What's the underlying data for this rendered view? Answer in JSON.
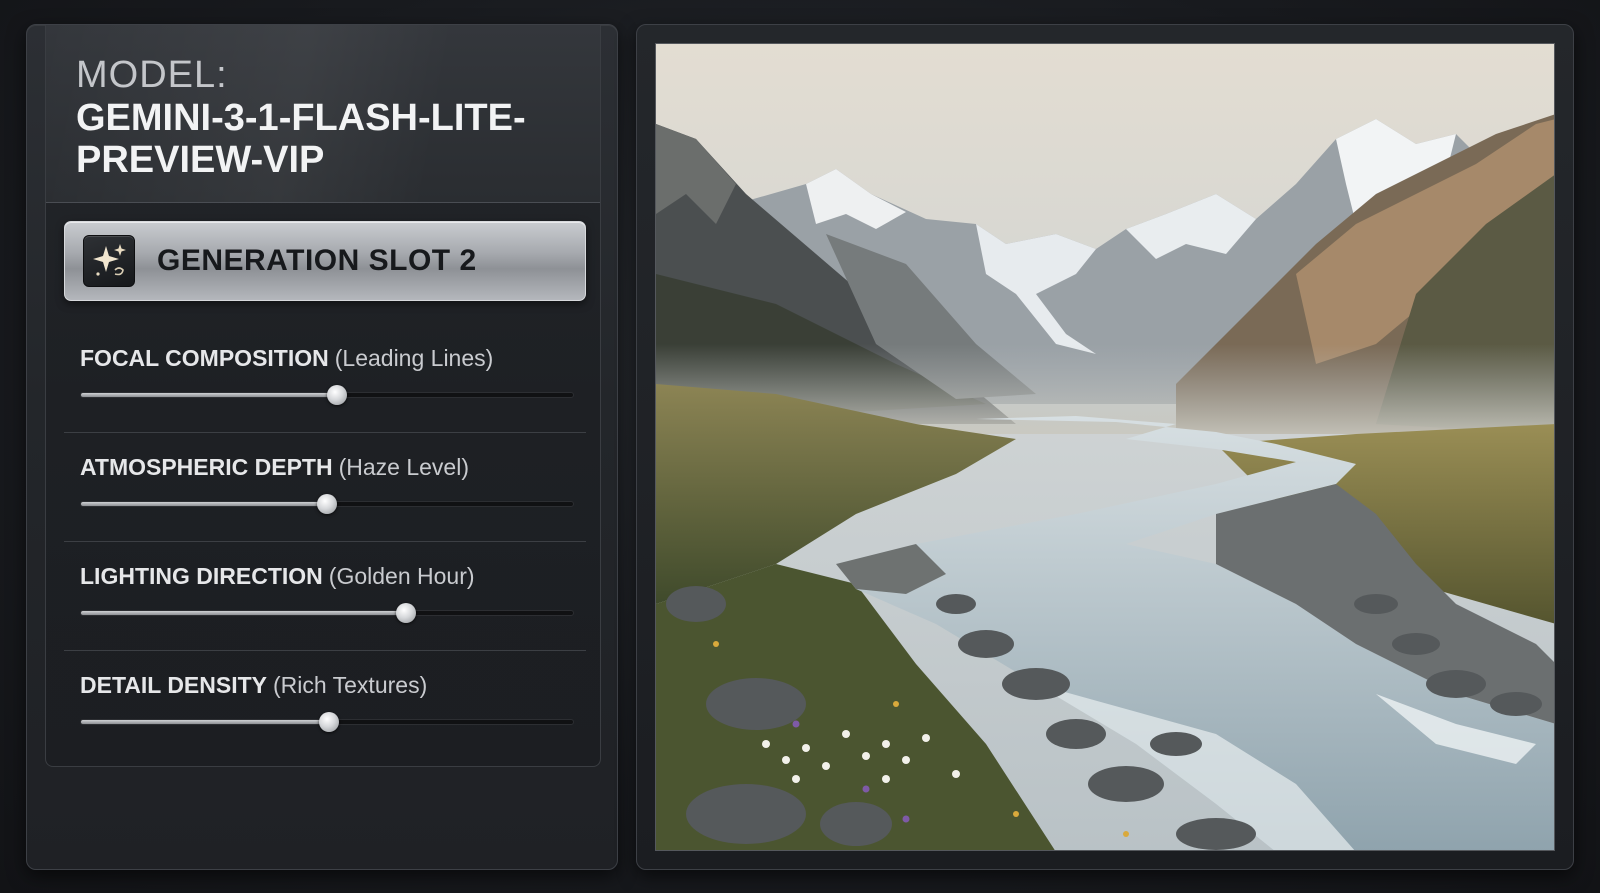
{
  "model": {
    "label": "MODEL:",
    "name": "GEMINI-3-1-FLASH-LITE-PREVIEW-VIP"
  },
  "slot": {
    "label": "GENERATION SLOT 2",
    "icon": "sparkle-icon"
  },
  "controls": [
    {
      "name": "FOCAL COMPOSITION",
      "hint": "(Leading Lines)",
      "value": 0.52
    },
    {
      "name": "ATMOSPHERIC DEPTH",
      "hint": "(Haze Level)",
      "value": 0.5
    },
    {
      "name": "LIGHTING DIRECTION",
      "hint": "(Golden Hour)",
      "value": 0.66
    },
    {
      "name": "DETAIL DENSITY",
      "hint": "(Rich Textures)",
      "value": 0.505
    }
  ],
  "preview": {
    "subject": "mountain-valley-river-landscape"
  },
  "colors": {
    "background": "#181a1e",
    "panel": "#2a2d31",
    "slot_button": "#a6a9ae",
    "text": "#e6e7e9"
  }
}
